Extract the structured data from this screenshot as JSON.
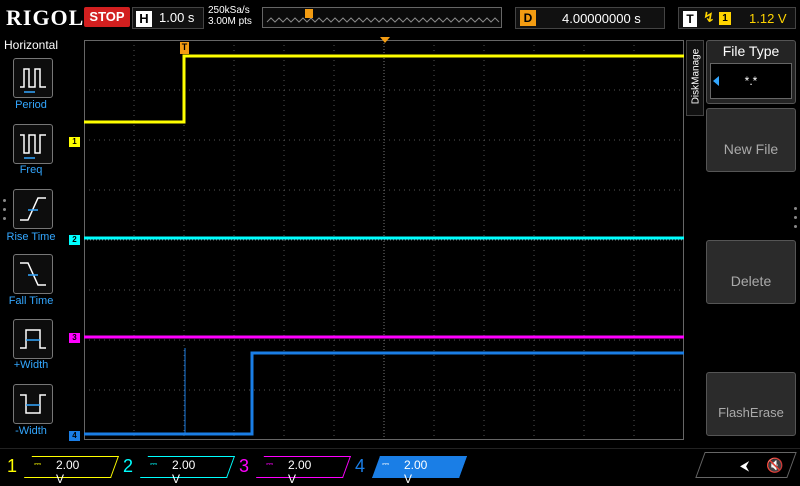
{
  "header": {
    "brand": "RIGOL",
    "run_state": "STOP",
    "horizontal_label": "H",
    "timebase": "1.00 s",
    "sample_rate": "250kSa/s",
    "memory_depth": "3.00M pts",
    "delay_label": "D",
    "delay": "4.00000000 s",
    "trigger_label": "T",
    "trigger_edge": "rising-edge-icon",
    "trigger_source": "1",
    "trigger_level": "1.12 V"
  },
  "left_menu": {
    "title": "Horizontal",
    "items": [
      {
        "label": "Period",
        "icon": "period-icon"
      },
      {
        "label": "Freq",
        "icon": "frequency-icon"
      },
      {
        "label": "Rise Time",
        "icon": "rise-time-icon"
      },
      {
        "label": "Fall Time",
        "icon": "fall-time-icon"
      },
      {
        "label": "+Width",
        "icon": "positive-width-icon"
      },
      {
        "label": "-Width",
        "icon": "negative-width-icon"
      }
    ]
  },
  "right_menu": {
    "tab": "DiskManage",
    "file_type_title": "File Type",
    "file_type_value": "*.*",
    "new_file": "New File",
    "delete": "Delete",
    "flash_erase": "FlashErase"
  },
  "channels": [
    {
      "num": "1",
      "scale": "2.00 V",
      "color": "#ffff00"
    },
    {
      "num": "2",
      "scale": "2.00 V",
      "color": "#00ffff"
    },
    {
      "num": "3",
      "scale": "2.00 V",
      "color": "#ff00ff"
    },
    {
      "num": "4",
      "scale": "2.00 V",
      "color": "#1a7ee6"
    }
  ],
  "status_icons": {
    "usb": "usb-icon",
    "sound": "speaker-muted-icon"
  }
}
